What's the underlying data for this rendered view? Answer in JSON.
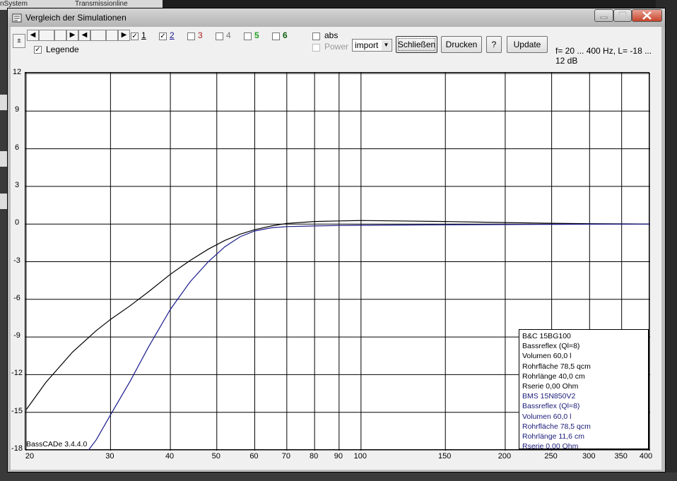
{
  "background": {
    "tab_left": "nSystem",
    "tab_right": "Transmissionline"
  },
  "window": {
    "title": "Vergleich der Simulationen"
  },
  "toolbar": {
    "plus_label": "±",
    "curve_checkboxes": [
      {
        "label": "1",
        "checked": true,
        "color": "#000000"
      },
      {
        "label": "2",
        "checked": true,
        "color": "#1a1a8c"
      },
      {
        "label": "3",
        "checked": false,
        "color": "#b02020"
      },
      {
        "label": "4",
        "checked": false,
        "color": "#777777"
      },
      {
        "label": "5",
        "checked": false,
        "color": "#20a020"
      },
      {
        "label": "6",
        "checked": false,
        "color": "#106010"
      }
    ],
    "legend_label": "Legende",
    "legend_checked": true,
    "abs_label": "abs",
    "power_label": "Power",
    "mode_value": "import",
    "close_label": "Schließen",
    "print_label": "Drucken",
    "help_label": "?",
    "update_label": "Update",
    "range_text": "f= 20 ... 400 Hz, L= -18 ... 12 dB"
  },
  "legend": {
    "set1": [
      "B&C 15BG100",
      "Bassreflex (Ql=8)",
      "Volumen 60,0 l",
      "Rohrfläche 78,5 qcm",
      "Rohrlänge 40,0 cm",
      "Rserie 0,00 Ohm"
    ],
    "set2": [
      "BMS 15N850V2",
      "Bassreflex (Ql=8)",
      "Volumen 60,0 l",
      "Rohrfläche 78,5 qcm",
      "Rohrlänge 11,6 cm",
      "Rserie 0,00 Ohm"
    ]
  },
  "watermark": "BassCADe 3.4.4.0",
  "chart_data": {
    "type": "line",
    "xscale": "log",
    "xlim": [
      20,
      400
    ],
    "ylim": [
      -18,
      12
    ],
    "yticks": [
      12,
      9,
      6,
      3,
      0,
      -3,
      -6,
      -9,
      -12,
      -15,
      -18
    ],
    "xticks": [
      20,
      30,
      40,
      50,
      60,
      70,
      80,
      90,
      100,
      150,
      200,
      250,
      300,
      350,
      400
    ],
    "grid": true,
    "series": [
      {
        "name": "B&C 15BG100",
        "color": "#000000",
        "x": [
          20,
          22,
          25,
          28,
          30,
          33,
          36,
          40,
          44,
          48,
          52,
          56,
          60,
          65,
          70,
          80,
          90,
          100,
          120,
          150,
          200,
          250,
          300,
          400
        ],
        "y": [
          -14.8,
          -12.6,
          -10.2,
          -8.5,
          -7.6,
          -6.5,
          -5.4,
          -4.0,
          -2.9,
          -2.0,
          -1.3,
          -0.8,
          -0.45,
          -0.15,
          0.05,
          0.2,
          0.25,
          0.28,
          0.25,
          0.2,
          0.12,
          0.06,
          0.03,
          0.0
        ]
      },
      {
        "name": "BMS 15N850V2",
        "color": "#1a1a8c",
        "x": [
          27,
          28,
          30,
          33,
          36,
          40,
          44,
          48,
          52,
          56,
          60,
          65,
          70,
          80,
          90,
          100,
          120,
          150,
          200,
          250,
          300,
          400
        ],
        "y": [
          -18,
          -17.2,
          -15.2,
          -12.5,
          -9.8,
          -6.8,
          -4.6,
          -3.0,
          -1.8,
          -1.0,
          -0.55,
          -0.3,
          -0.2,
          -0.15,
          -0.12,
          -0.1,
          -0.08,
          -0.06,
          -0.04,
          -0.02,
          -0.01,
          0.0
        ]
      }
    ]
  }
}
